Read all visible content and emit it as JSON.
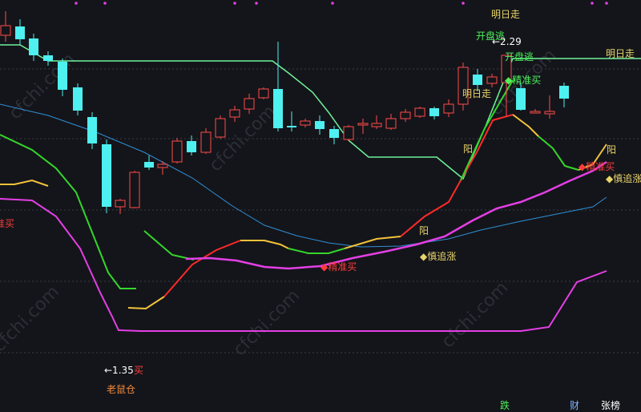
{
  "chart_data": {
    "type": "candlestick",
    "title": "",
    "xlabel": "",
    "ylabel": "",
    "ylim": [
      0,
      514
    ],
    "grid": true,
    "candles": [
      {
        "o": 470,
        "h": 500,
        "l": 462,
        "c": 482
      },
      {
        "o": 481,
        "h": 490,
        "l": 458,
        "c": 465
      },
      {
        "o": 466,
        "h": 472,
        "l": 438,
        "c": 445
      },
      {
        "o": 445,
        "h": 450,
        "l": 432,
        "c": 438
      },
      {
        "o": 437,
        "h": 441,
        "l": 394,
        "c": 402
      },
      {
        "o": 405,
        "h": 410,
        "l": 370,
        "c": 376
      },
      {
        "o": 368,
        "h": 374,
        "l": 328,
        "c": 335
      },
      {
        "o": 334,
        "h": 340,
        "l": 248,
        "c": 256
      },
      {
        "o": 256,
        "h": 266,
        "l": 247,
        "c": 264
      },
      {
        "o": 255,
        "h": 301,
        "l": 254,
        "c": 299
      },
      {
        "o": 312,
        "h": 320,
        "l": 302,
        "c": 305
      },
      {
        "o": 305,
        "h": 313,
        "l": 296,
        "c": 309
      },
      {
        "o": 312,
        "h": 342,
        "l": 310,
        "c": 338
      },
      {
        "o": 338,
        "h": 345,
        "l": 320,
        "c": 324
      },
      {
        "o": 324,
        "h": 354,
        "l": 322,
        "c": 349
      },
      {
        "o": 343,
        "h": 370,
        "l": 341,
        "c": 366
      },
      {
        "o": 368,
        "h": 382,
        "l": 362,
        "c": 377
      },
      {
        "o": 378,
        "h": 397,
        "l": 372,
        "c": 391
      },
      {
        "o": 392,
        "h": 405,
        "l": 390,
        "c": 403
      },
      {
        "o": 403,
        "h": 462,
        "l": 350,
        "c": 354
      },
      {
        "o": 357,
        "h": 375,
        "l": 350,
        "c": 355
      },
      {
        "o": 358,
        "h": 366,
        "l": 355,
        "c": 363
      },
      {
        "o": 363,
        "h": 370,
        "l": 346,
        "c": 353
      },
      {
        "o": 353,
        "h": 357,
        "l": 334,
        "c": 342
      },
      {
        "o": 340,
        "h": 358,
        "l": 338,
        "c": 356
      },
      {
        "o": 358,
        "h": 366,
        "l": 347,
        "c": 360
      },
      {
        "o": 356,
        "h": 370,
        "l": 353,
        "c": 360
      },
      {
        "o": 354,
        "h": 372,
        "l": 352,
        "c": 366
      },
      {
        "o": 366,
        "h": 378,
        "l": 362,
        "c": 374
      },
      {
        "o": 369,
        "h": 381,
        "l": 367,
        "c": 379
      },
      {
        "o": 379,
        "h": 381,
        "l": 365,
        "c": 369
      },
      {
        "o": 373,
        "h": 390,
        "l": 368,
        "c": 384
      },
      {
        "o": 384,
        "h": 436,
        "l": 376,
        "c": 430
      },
      {
        "o": 421,
        "h": 428,
        "l": 400,
        "c": 408
      },
      {
        "o": 410,
        "h": 422,
        "l": 405,
        "c": 418
      },
      {
        "o": 411,
        "h": 408,
        "l": 368,
        "c": 445
      },
      {
        "o": 404,
        "h": 411,
        "l": 376,
        "c": 377
      },
      {
        "o": 374,
        "h": 378,
        "l": 382,
        "c": 375
      },
      {
        "o": 372,
        "h": 395,
        "l": 366,
        "c": 375
      },
      {
        "o": 407,
        "h": 411,
        "l": 380,
        "c": 391
      }
    ],
    "annotations": {
      "low_marker": "←1.35",
      "low_marker_suffix": "买",
      "high_marker": "←2.29"
    }
  },
  "labels": {
    "lao_shu_cang": "老鼠仓",
    "ming_ri_zou_top": "明日走",
    "ming_ri_zou_right": "明日走",
    "ming_ri_zou_mid": "明日走",
    "kai_pan_tao_1": "开盘逃",
    "kai_pan_tao_2": "开盘逃",
    "jing_zhun_mai_mid": "◆精准买",
    "jing_zhun_mai_top": "◆精准买",
    "jing_zhun_mai_right": "◆精准买",
    "zhun_mai_left": "准买",
    "yang_1": "阳",
    "yang_2": "阳",
    "yang_3": "阳",
    "shen_zhui_zhang_1": "◆慎追涨",
    "shen_zhui_zhang_2": "◆慎追涨",
    "watermark": "cfchi.com"
  },
  "tabs": {
    "die": "跌",
    "cai": "财",
    "zhang_bang": "张榜"
  },
  "colors": {
    "background": "#14151a",
    "up": "#ff4a4a",
    "down": "#4ef0f0",
    "green_band": "#6ef29a",
    "blue_ma": "#2f8fd6",
    "magenta": "#e43fe6",
    "yellow": "#f2c23b",
    "red_line": "#ff2a2a",
    "label_yellow": "#e8d56a",
    "label_green": "#4cf25c"
  }
}
